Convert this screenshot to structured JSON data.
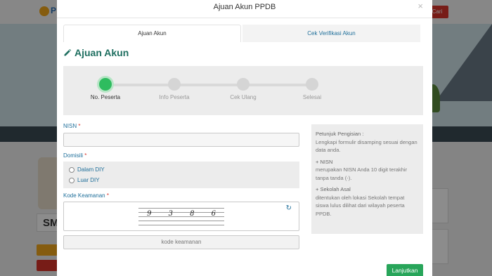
{
  "background": {
    "logo_text": "P",
    "search_label": "Cari",
    "school_initials": "SM"
  },
  "modal": {
    "title": "Ajuan Akun PPDB",
    "close_symbol": "×"
  },
  "tabs": [
    {
      "label": "Ajuan Akun",
      "active": true
    },
    {
      "label": "Cek Verifikasi Akun",
      "active": false
    }
  ],
  "section_title": "Ajuan Akun",
  "stepper": {
    "current_step": 1,
    "steps": [
      {
        "label": "No. Peserta"
      },
      {
        "label": "Info Peserta"
      },
      {
        "label": "Cek Ulang"
      },
      {
        "label": "Selesai"
      }
    ]
  },
  "form": {
    "nisn": {
      "label": "NISN",
      "required_mark": "*",
      "value": ""
    },
    "domisili": {
      "label": "Domisili",
      "required_mark": "*",
      "options": [
        "Dalam DIY",
        "Luar DIY"
      ]
    },
    "captcha": {
      "label": "Kode Keamanan",
      "required_mark": "*",
      "digits": [
        "9",
        "3",
        "8",
        "6"
      ],
      "refresh_icon": "refresh-icon",
      "placeholder": "kode keamanan"
    }
  },
  "help": {
    "title": "Petunjuk Pengisian :",
    "intro": "Lengkapi formulir disamping sesuai dengan data anda.",
    "nisn_title": "+ NISN",
    "nisn_text": "merupakan NISN Anda 10 digit terakhir tanpa tanda (-).",
    "school_title": "+ Sekolah Asal",
    "school_text": "ditentukan oleh lokasi Sekolah tempat siswa lulus dilihat dari wilayah peserta PPDB."
  },
  "submit_label": "Lanjutkan",
  "colors": {
    "accent_green": "#28a55a",
    "active_step": "#2ebc5f",
    "link_blue": "#1f6f9a",
    "required_red": "#d9342b"
  }
}
